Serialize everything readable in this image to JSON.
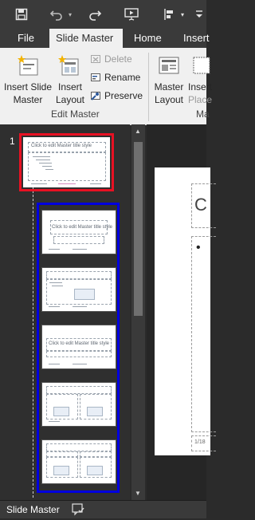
{
  "tabs": {
    "file": "File",
    "slide_master": "Slide Master",
    "home": "Home",
    "insert": "Insert"
  },
  "ribbon": {
    "insert_slide_master": [
      "Insert Slide",
      "Master"
    ],
    "insert_layout": [
      "Insert",
      "Layout"
    ],
    "delete": "Delete",
    "rename": "Rename",
    "preserve": "Preserve",
    "edit_master_group": "Edit Master",
    "master_layout": [
      "Master",
      "Layout"
    ],
    "insert_placeholder_partial": [
      "Insert",
      "Place"
    ],
    "next_group_partial": "Ma"
  },
  "thumbnails": {
    "master_number": "1",
    "title_placeholder": "Click to edit Master title style",
    "layout_title": "Click to edit Master title style"
  },
  "editor": {
    "title_partial": "C",
    "bullet": "•",
    "footer_partial": "1/18"
  },
  "status": {
    "mode": "Slide Master"
  },
  "colors": {
    "selected_master_border": "#e81123",
    "layouts_border": "#0000e0",
    "ribbon_bg": "#f0f0f0",
    "dark_bg": "#2b2b2b"
  }
}
